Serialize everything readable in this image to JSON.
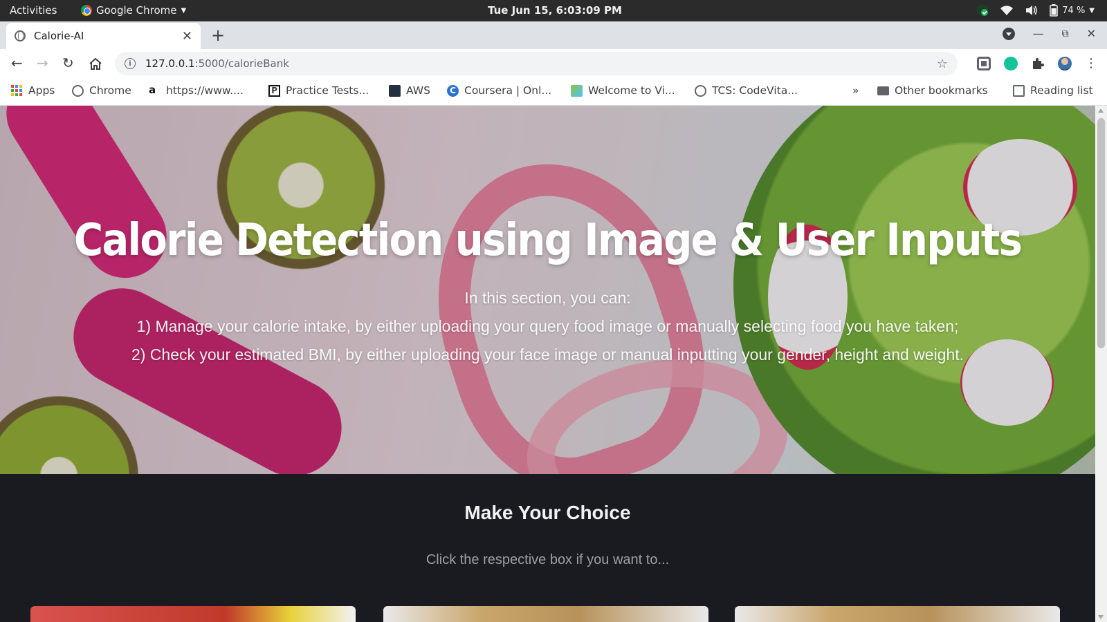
{
  "system_bar": {
    "activities": "Activities",
    "app_name": "Google Chrome",
    "clock": "Tue Jun 15,  6:03:09 PM",
    "battery": "74 %"
  },
  "browser": {
    "tab_title": "Calorie-AI",
    "url_host": "127.0.0.1",
    "url_path": ":5000/calorieBank",
    "bookmarks": [
      {
        "label": "Apps",
        "icon": "apps-grid-icon"
      },
      {
        "label": "Chrome",
        "icon": "globe-icon"
      },
      {
        "label": "https://www....",
        "icon": "amazon-icon"
      },
      {
        "label": "Practice Tests...",
        "icon": "practice-tests-icon"
      },
      {
        "label": "AWS",
        "icon": "aws-icon"
      },
      {
        "label": "Coursera | Onl...",
        "icon": "coursera-icon"
      },
      {
        "label": "Welcome to Vi...",
        "icon": "virtual-lab-icon"
      },
      {
        "label": "TCS: CodeVita...",
        "icon": "globe-icon"
      }
    ],
    "overflow": "»",
    "other_bookmarks": "Other bookmarks",
    "reading_list": "Reading list"
  },
  "hero": {
    "title": "Calorie Detection using Image & User Inputs",
    "intro": "In this section, you can:",
    "point1": "1) Manage your calorie intake, by either uploading your query food image or manually selecting food you have taken;",
    "point2": "2) Check your estimated BMI, by either uploading your face image or manual inputting your gender, height and weight."
  },
  "choice": {
    "title": "Make Your Choice",
    "subtitle": "Click the respective box if you want to..."
  },
  "colors": {
    "hero_tint": "#e6d4da",
    "dark_section": "#1a1b21",
    "dumbbell": "#e0247a",
    "tape": "#e8708f",
    "kiwi": "#8fae2a",
    "lettuce": "#6fae2f",
    "radish": "#d8234a"
  }
}
